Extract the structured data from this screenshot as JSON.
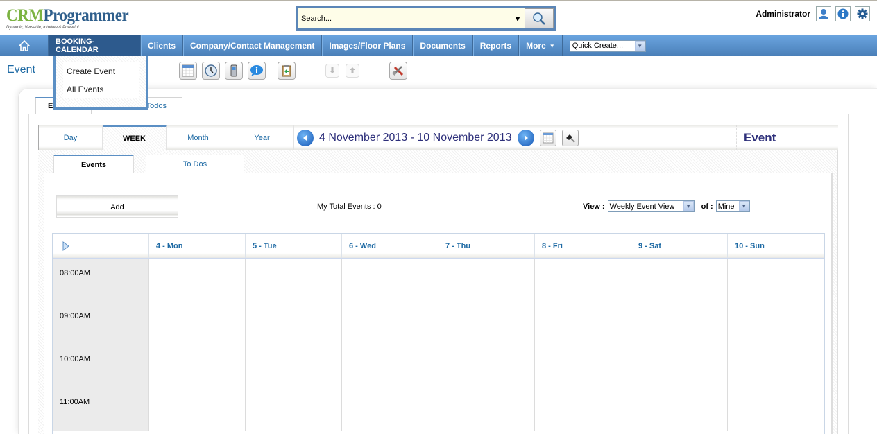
{
  "header": {
    "logo_crm": "CRM",
    "logo_programmer": "Programmer",
    "logo_tagline": "Dynamic, Versatile, Intuitive & Powerful.",
    "search_placeholder": "Search...",
    "user_name": "Administrator",
    "icons": [
      "user-icon",
      "info-icon",
      "settings-icon"
    ]
  },
  "nav": {
    "items": [
      {
        "label": "BOOKING-CALENDAR",
        "active": true
      },
      {
        "label": "Clients"
      },
      {
        "label": "Company/Contact Management"
      },
      {
        "label": "Images/Floor Plans"
      },
      {
        "label": "Documents"
      },
      {
        "label": "Reports"
      },
      {
        "label": "More"
      }
    ],
    "quick_create": "Quick Create..."
  },
  "dropdown": {
    "items": [
      "Create Event",
      "All Events"
    ]
  },
  "page": {
    "title": "Event",
    "toolbar_icons": [
      "calendar-icon",
      "clock-icon",
      "mobile-icon",
      "chat-info-icon",
      "clipboard-import-icon",
      "import-icon",
      "export-icon",
      "tools-icon"
    ]
  },
  "outer_tabs": [
    {
      "label": "Events",
      "active": true
    },
    {
      "label": "Todos"
    }
  ],
  "view_tabs": [
    {
      "label": "Day"
    },
    {
      "label": "WEEK",
      "active": true
    },
    {
      "label": "Month"
    },
    {
      "label": "Year"
    }
  ],
  "date_range": "4 November 2013 - 10 November 2013",
  "view_title": "Event",
  "sub_tabs": [
    {
      "label": "Events",
      "active": true
    },
    {
      "label": "To Dos"
    }
  ],
  "content": {
    "add_label": "Add",
    "total_events": "My Total Events : 0",
    "view_label": "View :",
    "view_value": "Weekly Event View",
    "of_label": "of :",
    "of_value": "Mine"
  },
  "calendar": {
    "days": [
      "4 - Mon",
      "5 - Tue",
      "6 - Wed",
      "7 - Thu",
      "8 - Fri",
      "9 - Sat",
      "10 - Sun"
    ],
    "times": [
      "08:00AM",
      "09:00AM",
      "10:00AM",
      "11:00AM"
    ]
  }
}
